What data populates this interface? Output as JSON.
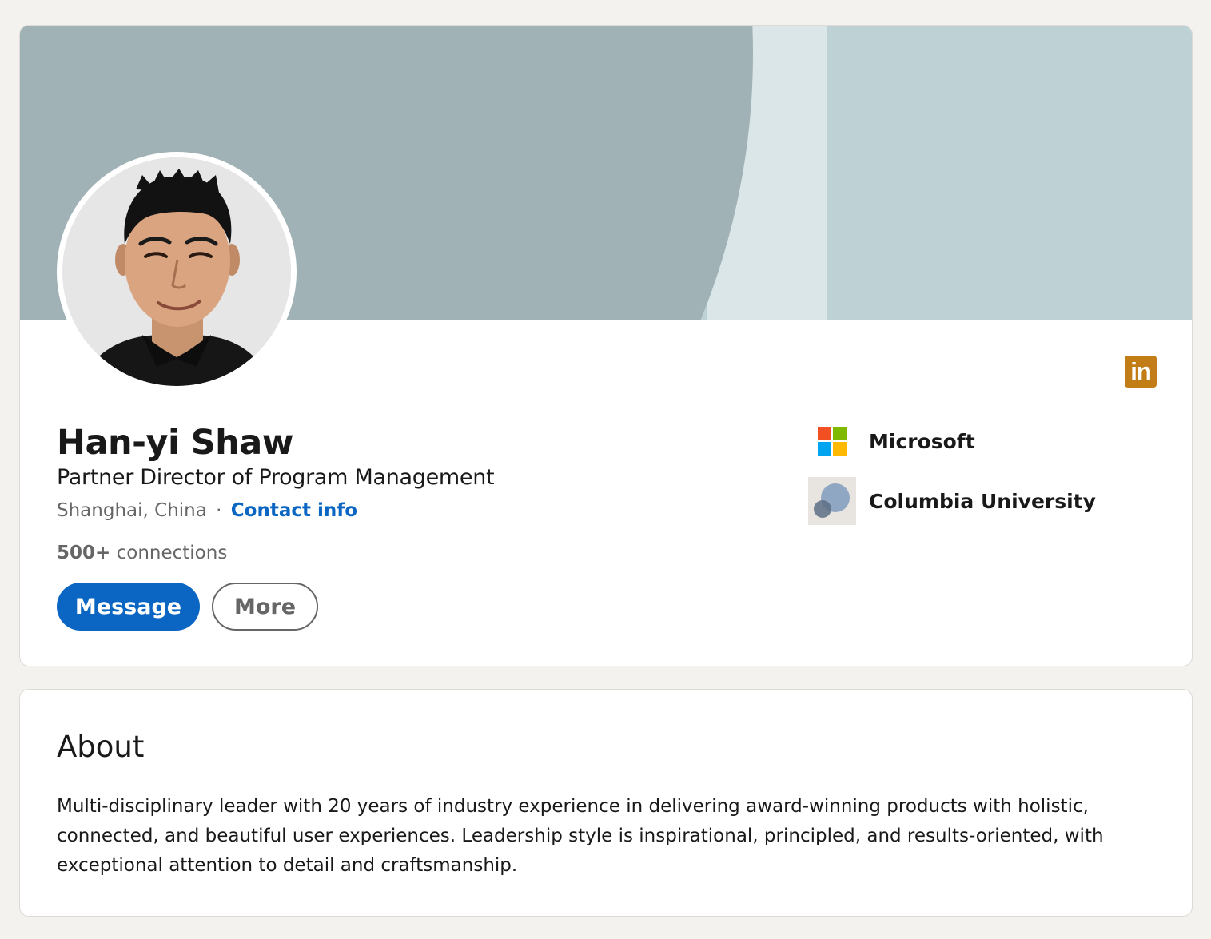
{
  "profile": {
    "name": "Han-yi Shaw",
    "headline": "Partner Director of Program Management",
    "location": "Shanghai, China",
    "separator": "·",
    "contact_info": "Contact info",
    "connections_count": "500+",
    "connections_label": "connections",
    "message_label": "Message",
    "more_label": "More",
    "avatar_icon": "profile-photo",
    "badge_text": "in"
  },
  "organizations": [
    {
      "name": "Microsoft",
      "icon": "microsoft-logo"
    },
    {
      "name": "Columbia University",
      "icon": "columbia-university-logo"
    }
  ],
  "about": {
    "title": "About",
    "text": "Multi-disciplinary leader with 20 years of industry experience in delivering award-winning products with holistic, connected, and beautiful user experiences. Leadership style is inspirational, principled, and results-oriented, with exceptional attention to detail and craftsmanship."
  },
  "colors": {
    "accent": "#0a66c2",
    "banner_light": "#bed2d6",
    "banner_dark": "#a0b2b5",
    "badge": "#c37d16"
  }
}
